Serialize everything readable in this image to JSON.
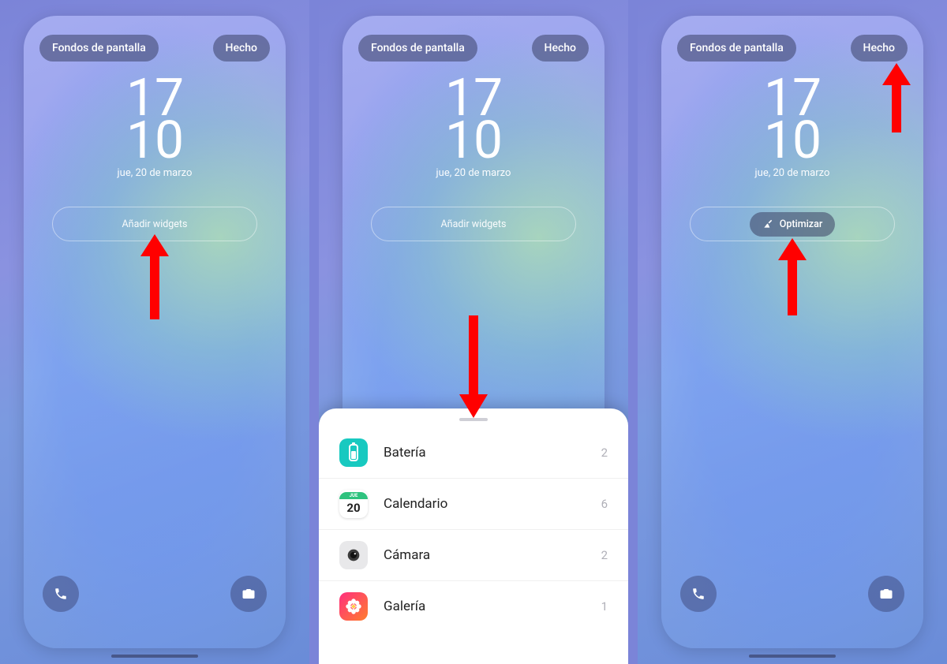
{
  "common": {
    "wallpapers_label": "Fondos de pantalla",
    "done_label": "Hecho",
    "clock_hh": "17",
    "clock_mm": "10",
    "clock_date": "jue, 20 de marzo",
    "add_widgets_label": "Añadir widgets"
  },
  "screen3": {
    "optimize_label": "Optimizar"
  },
  "sheet": {
    "items": [
      {
        "label": "Batería",
        "count": "2",
        "icon": "battery",
        "bg": "#18c9c0"
      },
      {
        "label": "Calendario",
        "count": "6",
        "icon": "calendar",
        "bg": "#ffffff",
        "day_badge_top": "JUE",
        "day_badge_num": "20"
      },
      {
        "label": "Cámara",
        "count": "2",
        "icon": "camera",
        "bg": "#e8e8ea"
      },
      {
        "label": "Galería",
        "count": "1",
        "icon": "gallery",
        "bg": "#ff2e7e"
      }
    ]
  }
}
